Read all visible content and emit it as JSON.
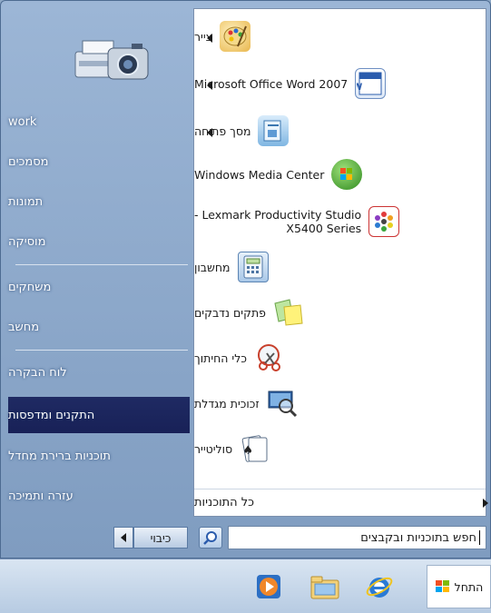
{
  "places": {
    "items": [
      {
        "label": "work"
      },
      {
        "label": "מסמכים"
      },
      {
        "label": "תמונות"
      },
      {
        "label": "מוסיקה"
      },
      {
        "label": "משחקים"
      },
      {
        "label": "מחשב"
      },
      {
        "label": "לוח הבקרה"
      },
      {
        "label": "התקנים ומדפסות"
      },
      {
        "label": "תוכניות ברירת מחדל"
      },
      {
        "label": "עזרה ותמיכה"
      }
    ]
  },
  "programs": {
    "items": [
      {
        "label": "צייר",
        "icon": "paint-icon"
      },
      {
        "label": "Microsoft Office Word 2007",
        "icon": "word-icon"
      },
      {
        "label": "מסך פתיחה",
        "icon": "getting-started-icon"
      },
      {
        "label": "Windows Media Center",
        "icon": "media-center-icon"
      },
      {
        "label": "Lexmark Productivity Studio -",
        "label2": "X5400 Series",
        "icon": "lexmark-icon"
      },
      {
        "label": "מחשבון",
        "icon": "calculator-icon"
      },
      {
        "label": "פתקים נדבקים",
        "icon": "sticky-notes-icon"
      },
      {
        "label": "כלי החיתוך",
        "icon": "snipping-tool-icon"
      },
      {
        "label": "זכוכית מגדלת",
        "icon": "magnifier-icon"
      },
      {
        "label": "סוליטייר",
        "icon": "solitaire-icon"
      }
    ],
    "all_programs": "כל התוכניות"
  },
  "search": {
    "placeholder": "חפש בתוכניות ובקבצים"
  },
  "shutdown": {
    "label": "כיבוי"
  },
  "taskbar": {
    "start_label": "התחל"
  }
}
